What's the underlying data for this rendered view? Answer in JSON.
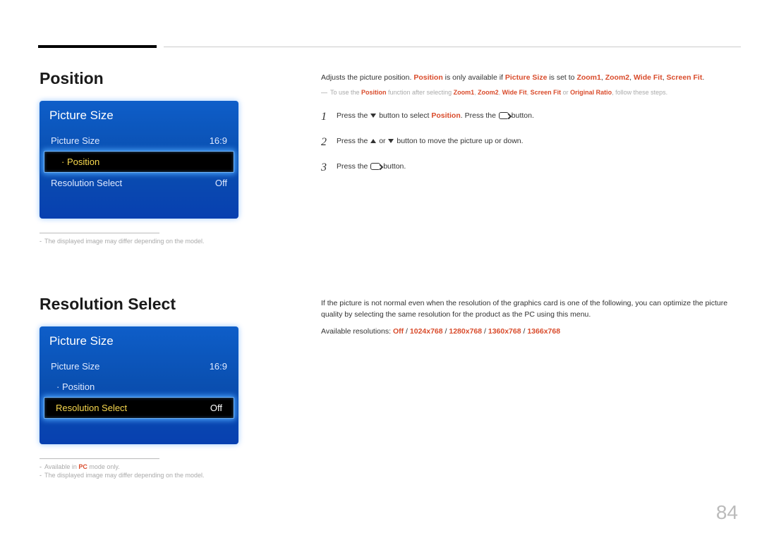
{
  "page_number": "84",
  "section1": {
    "title": "Position",
    "osd": {
      "header": "Picture Size",
      "row1_label": "Picture Size",
      "row1_value": "16:9",
      "row2_label": "·  Position",
      "row3_label": "Resolution Select",
      "row3_value": "Off"
    },
    "footnote": "The displayed image may differ depending on the model.",
    "desc_pre": "Adjusts the picture position. ",
    "desc_pos": "Position",
    "desc_mid": " is only available if ",
    "desc_ps": "Picture Size",
    "desc_mid2": " is set to ",
    "opts": {
      "z1": "Zoom1",
      "z2": "Zoom2",
      "wf": "Wide Fit",
      "sf": "Screen Fit"
    },
    "note_pre": "To use the ",
    "note_mid": " function after selecting ",
    "note_or": " or ",
    "note_orr": "Original Ratio",
    "note_end": ", follow these steps.",
    "step1a": "Press the ",
    "step1b": " button to select ",
    "step1c": ". Press the ",
    "step1d": " button.",
    "step2a": "Press the ",
    "step2b": " or ",
    "step2c": " button to move the picture up or down.",
    "step3a": "Press the ",
    "step3b": " button."
  },
  "section2": {
    "title": "Resolution Select",
    "osd": {
      "header": "Picture Size",
      "row1_label": "Picture Size",
      "row1_value": "16:9",
      "row2_label": "·  Position",
      "row3_label": "Resolution Select",
      "row3_value": "Off"
    },
    "foot1_pre": "Available in ",
    "foot1_pc": "PC",
    "foot1_post": " mode only.",
    "foot2": "The displayed image may differ depending on the model.",
    "desc": "If the picture is not normal even when the resolution of the graphics card is one of the following, you can optimize the picture quality by selecting the same resolution for the product as the PC using this menu.",
    "avail_label": "Available resolutions: ",
    "res": {
      "off": "Off",
      "r1": "1024x768",
      "r2": "1280x768",
      "r3": "1360x768",
      "r4": "1366x768"
    }
  }
}
